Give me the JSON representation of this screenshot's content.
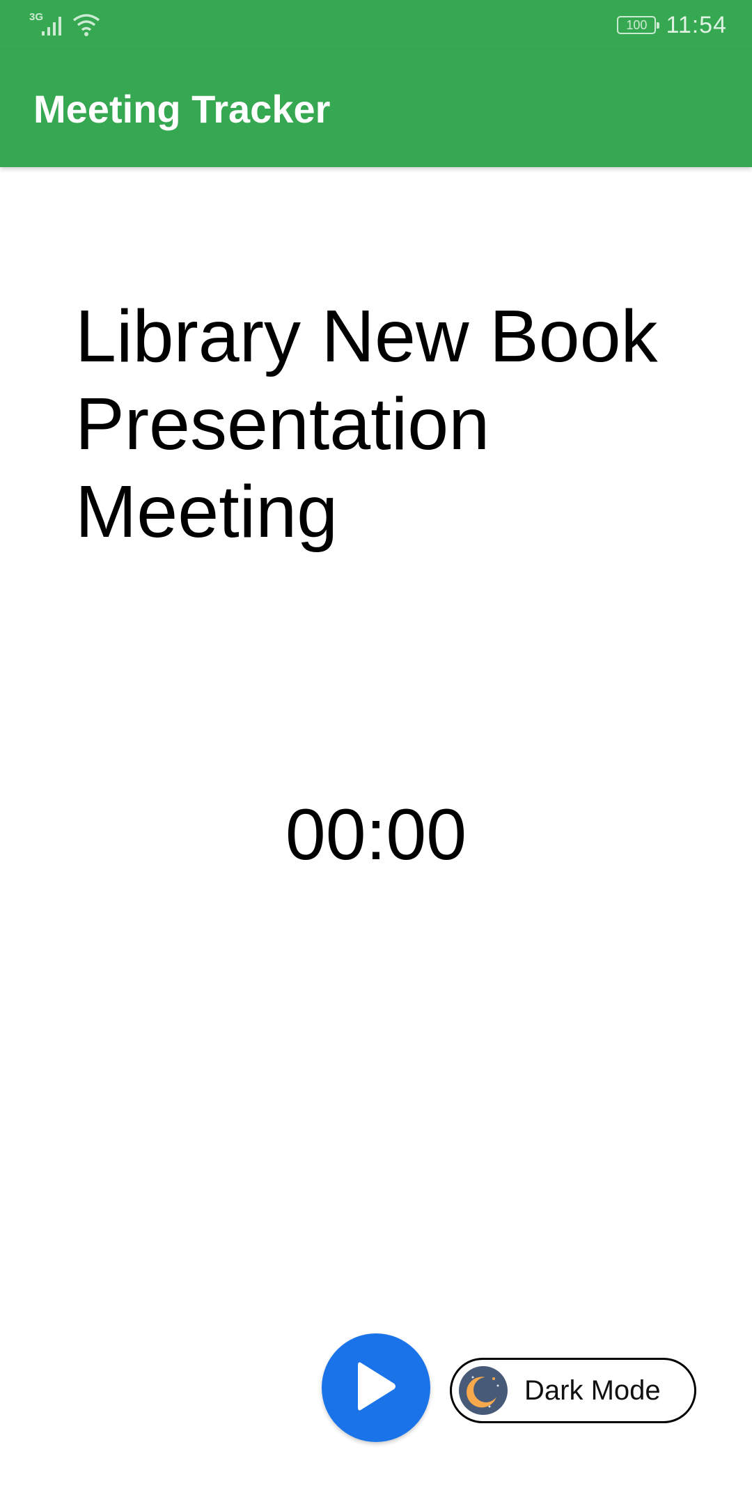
{
  "status_bar": {
    "network_type": "3G",
    "battery_level": "100",
    "time": "11:54"
  },
  "app_bar": {
    "title": "Meeting Tracker"
  },
  "meeting": {
    "title": "Library New Book Presentation Meeting",
    "timer": "00:00"
  },
  "controls": {
    "play_icon": "play-icon",
    "dark_mode_label": "Dark Mode",
    "dark_mode_icon": "moon-icon"
  },
  "colors": {
    "app_bar": "#37a852",
    "play_button": "#1a73e8",
    "moon_badge": "#475a78",
    "moon": "#f7a94b"
  }
}
